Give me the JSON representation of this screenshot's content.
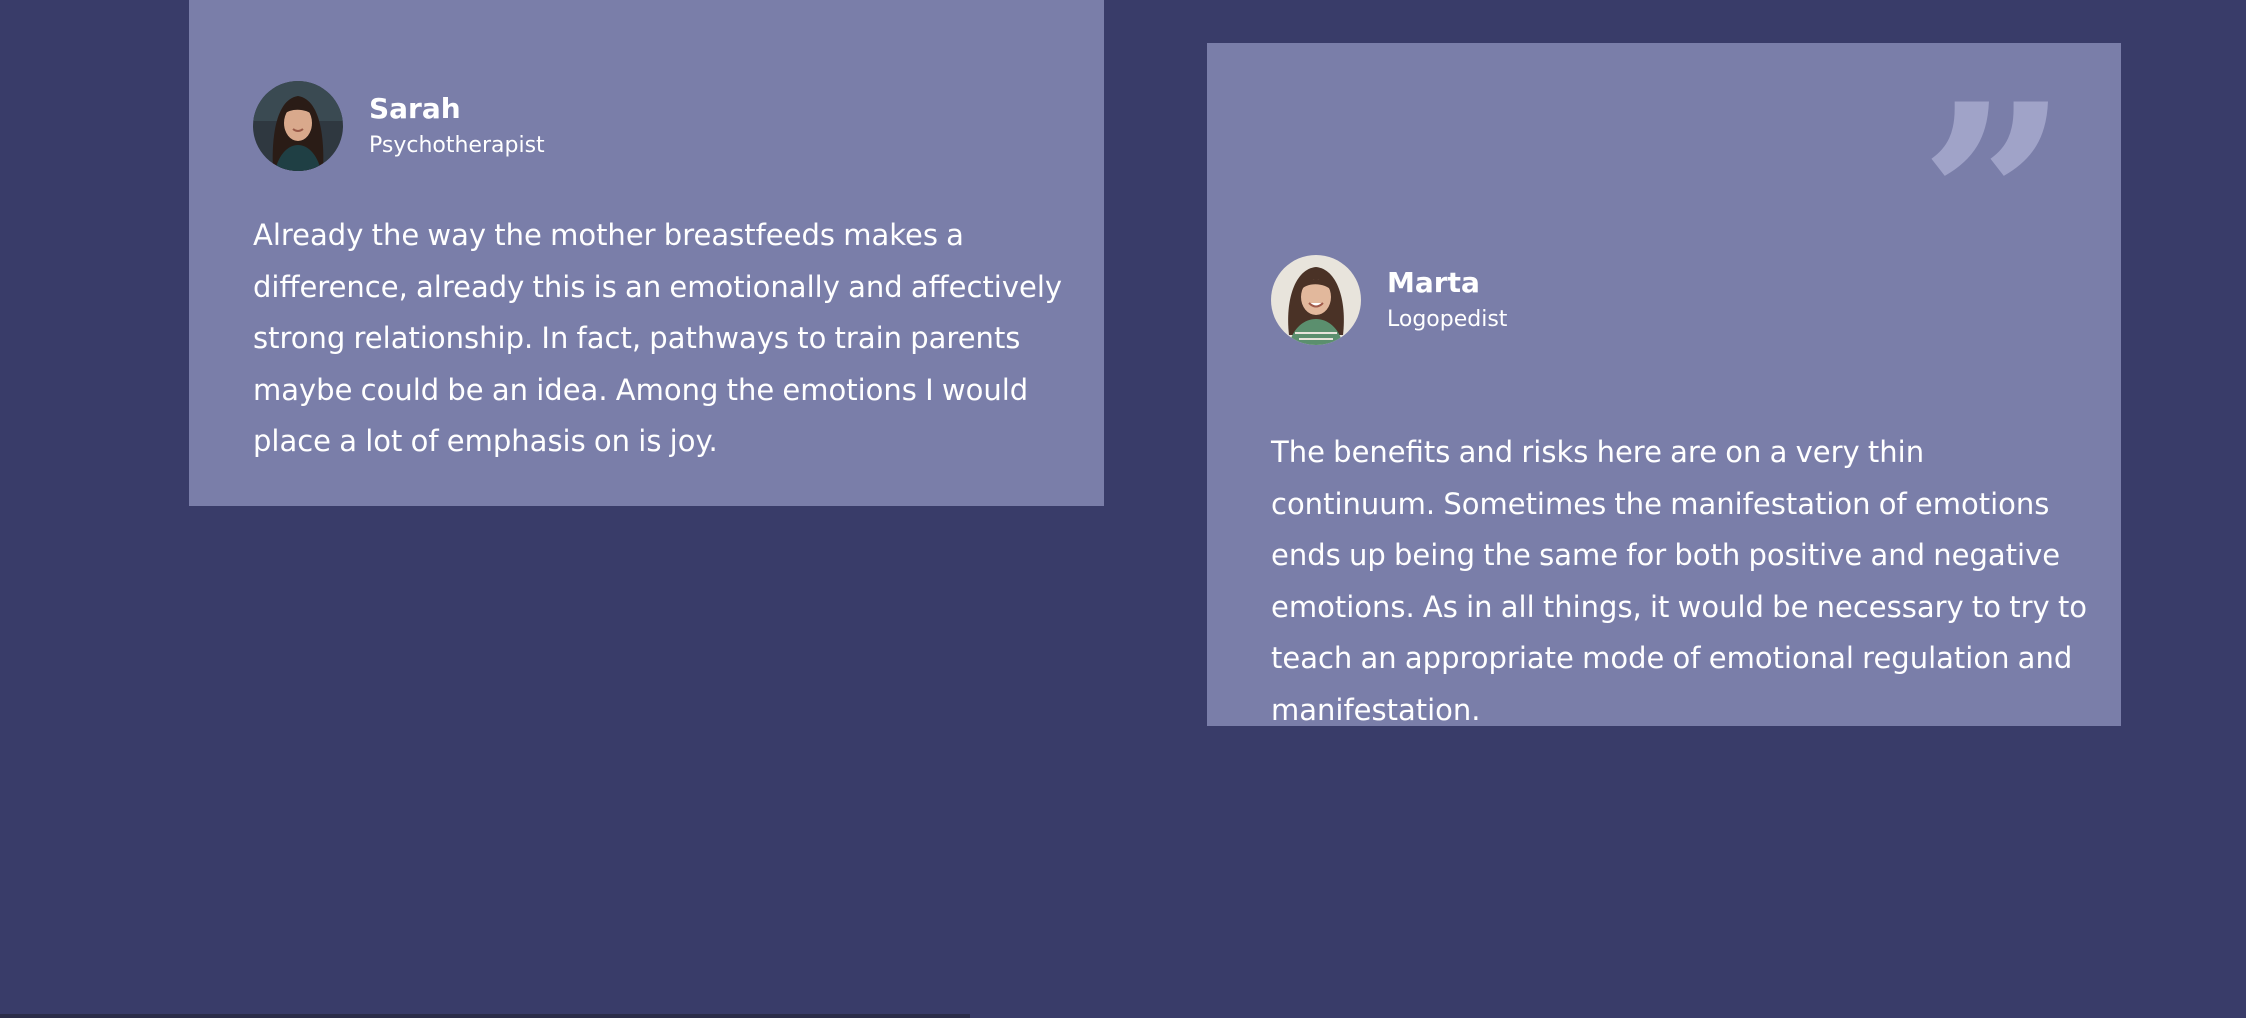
{
  "testimonials": [
    {
      "name": "Sarah",
      "role": "Psychotherapist",
      "quote_mark": "”",
      "text": "Already the way the mother breastfeeds makes a difference, already this is an emotionally and affectively strong relationship. In fact, pathways to train parents maybe could be an idea. Among the emotions I would place a lot of emphasis on is joy."
    },
    {
      "name": "Marta",
      "role": "Logopedist",
      "quote_mark": "”",
      "text": "The benefits and risks here are on a very thin continuum. Sometimes the manifestation of emotions ends up being the same for both positive and negative emotions. As in all things, it would be necessary to try to teach an appropriate mode of emotional regulation and manifestation."
    }
  ],
  "colors": {
    "background": "#393c69",
    "card": "#7a7ea9",
    "quote_mark": "#a0a3c8",
    "text": "#ffffff"
  },
  "icons": {
    "quote": "closing-quote-icon"
  }
}
